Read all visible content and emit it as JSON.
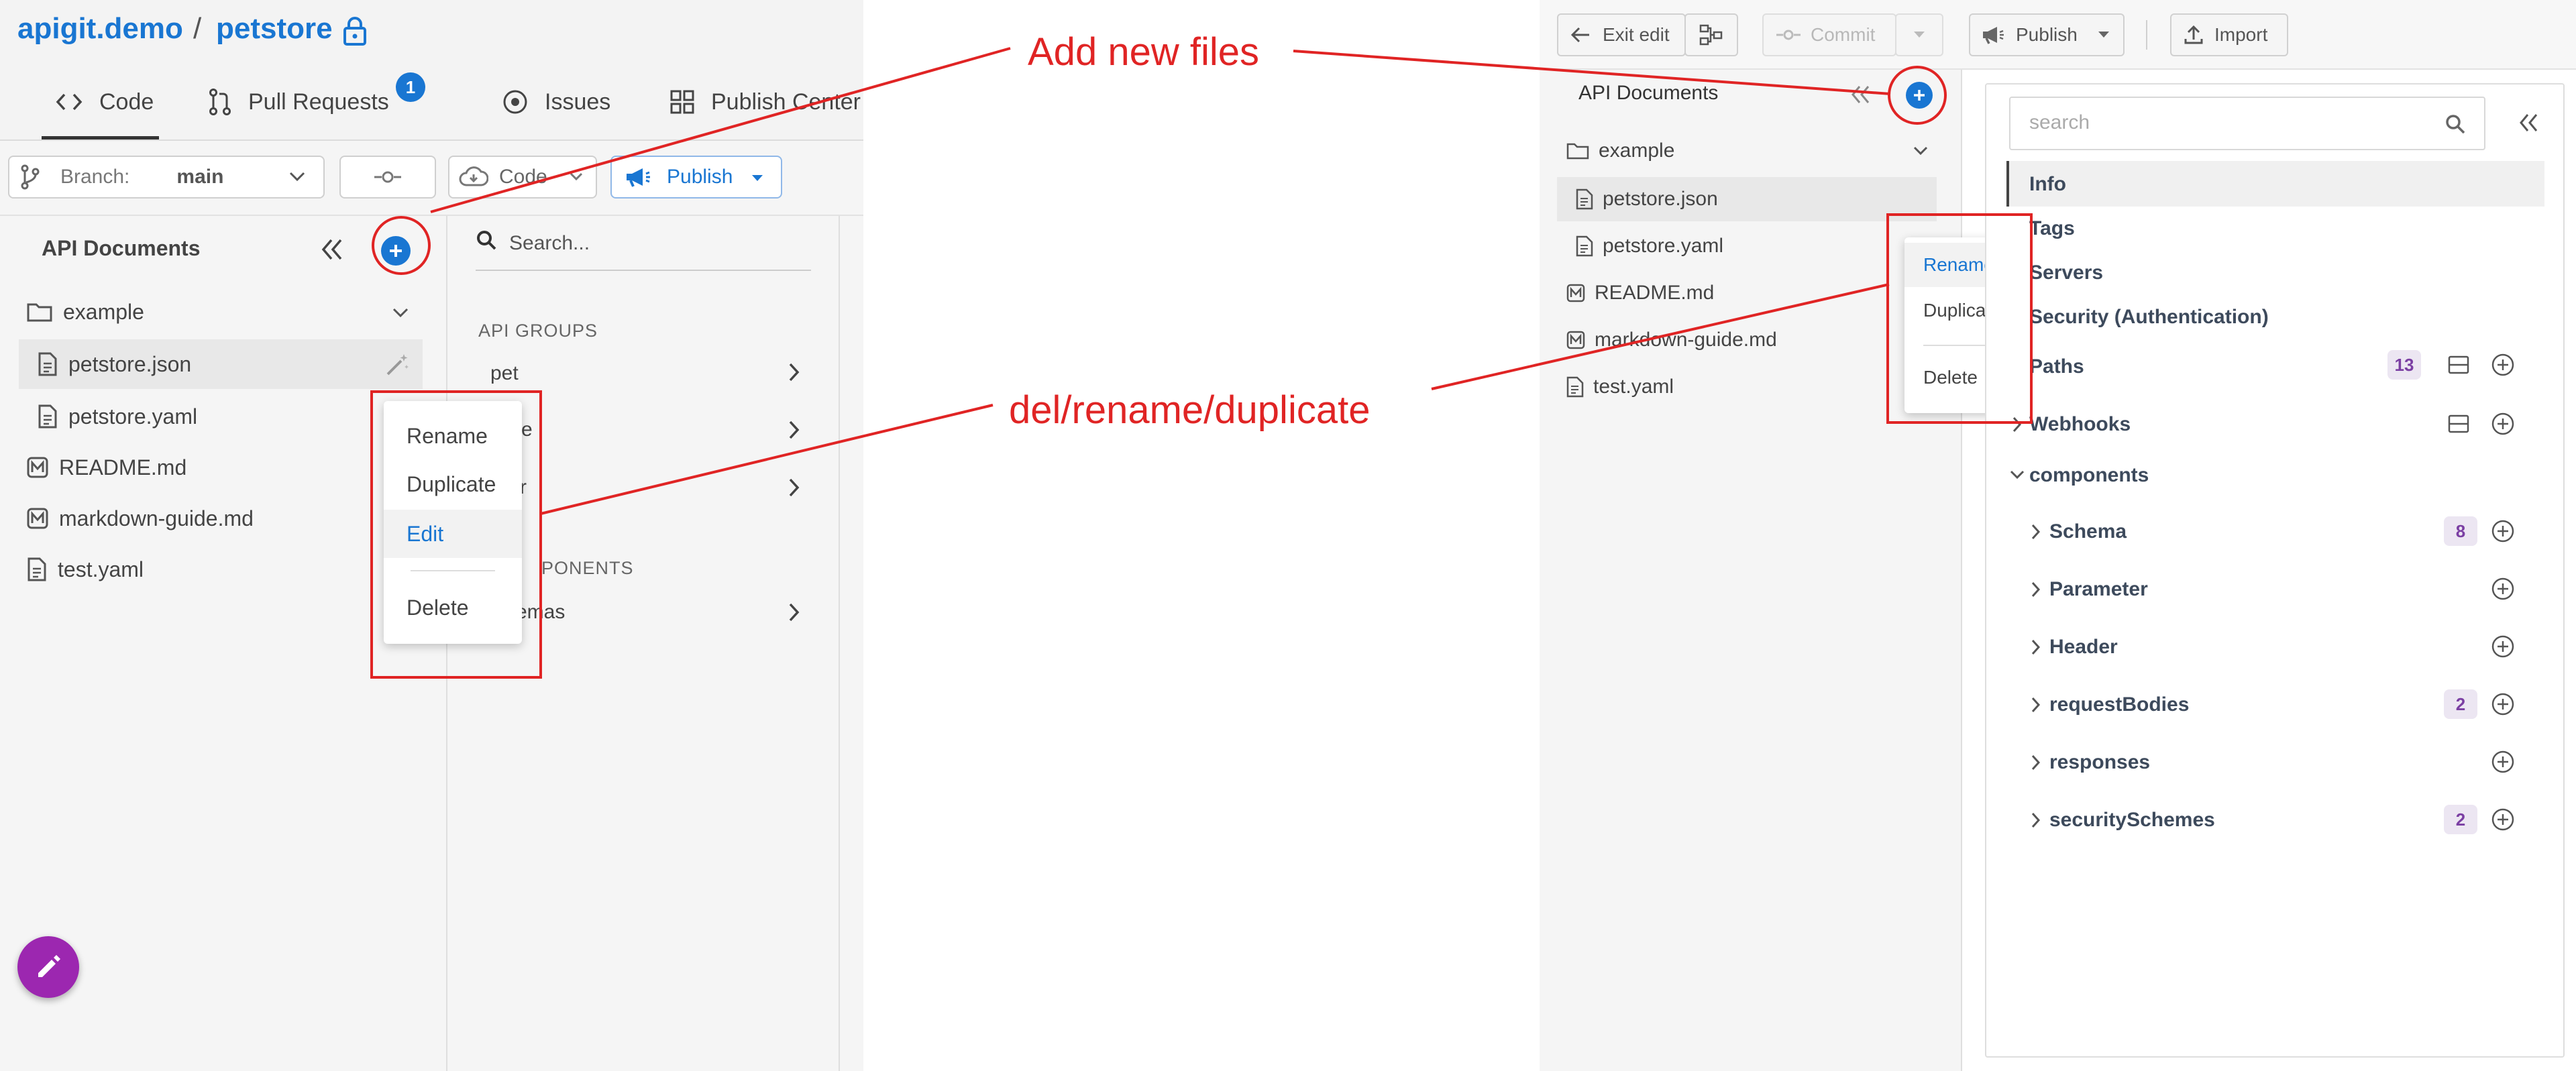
{
  "left": {
    "breadcrumb": {
      "org": "apigit.demo",
      "sep": "/",
      "repo": "petstore"
    },
    "tabs": [
      {
        "label": "Code",
        "icon": "code-icon"
      },
      {
        "label": "Pull Requests",
        "icon": "pull-request-icon",
        "badge": "1"
      },
      {
        "label": "Issues",
        "icon": "issues-icon"
      },
      {
        "label": "Publish Center",
        "icon": "grid-icon"
      }
    ],
    "toolbar": {
      "branch_label": "Branch:",
      "branch_value": "main",
      "code_label": "Code",
      "publish_label": "Publish"
    },
    "sidebar": {
      "title": "API Documents",
      "folder": "example",
      "files": [
        "petstore.json",
        "petstore.yaml",
        "README.md",
        "markdown-guide.md",
        "test.yaml"
      ]
    },
    "context_menu": [
      "Rename",
      "Duplicate",
      "Edit",
      "Delete"
    ],
    "mid": {
      "search_placeholder": "Search...",
      "groups_label": "API GROUPS",
      "groups": [
        "pet",
        "re",
        "r"
      ],
      "components_label": "PONENTS",
      "components": [
        "emas"
      ]
    }
  },
  "right": {
    "toolbar": {
      "exit_edit": "Exit edit",
      "commit": "Commit",
      "publish": "Publish",
      "import": "Import"
    },
    "sidebar": {
      "title": "API Documents",
      "folder": "example",
      "files": [
        "petstore.json",
        "petstore.yaml",
        "README.md",
        "markdown-guide.md",
        "test.yaml"
      ]
    },
    "context_menu": [
      "Rename",
      "Duplicate",
      "Delete"
    ],
    "panel": {
      "search_placeholder": "search",
      "top_items": [
        "Info",
        "Tags",
        "Servers",
        "Security (Authentication)"
      ],
      "paths": {
        "label": "Paths",
        "count": "13"
      },
      "webhooks": "Webhooks",
      "components": "components",
      "component_items": [
        {
          "label": "Schema",
          "count": "8"
        },
        {
          "label": "Parameter",
          "count": ""
        },
        {
          "label": "Header",
          "count": ""
        },
        {
          "label": "requestBodies",
          "count": "2"
        },
        {
          "label": "responses",
          "count": ""
        },
        {
          "label": "securitySchemes",
          "count": "2"
        }
      ]
    }
  },
  "annotations": {
    "add_new_files": "Add new files",
    "del_rename_duplicate": "del/rename/duplicate"
  },
  "colors": {
    "accent": "#1976d2",
    "annotation": "#e02424",
    "fab": "#9c27b0",
    "badge_bg": "#ece6f2",
    "badge_text": "#7b3fa3"
  }
}
